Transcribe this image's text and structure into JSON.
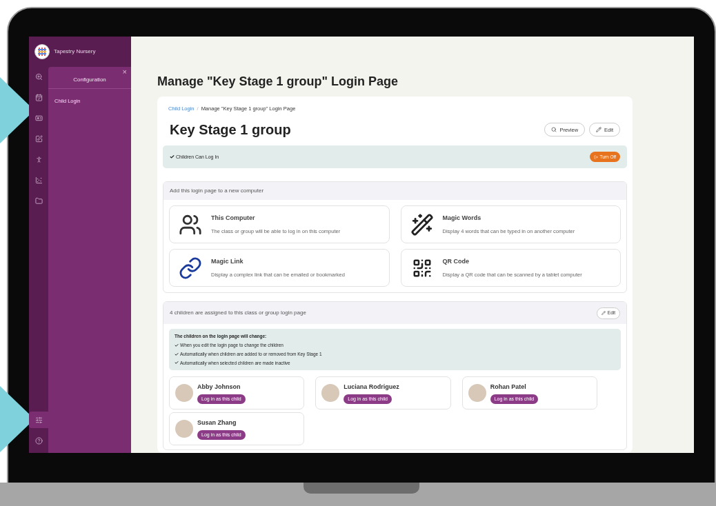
{
  "sidebar": {
    "brand": "Tapestry Nursery",
    "rail": [
      {
        "kind": "zoom",
        "selected": false
      },
      {
        "kind": "calendar",
        "selected": false
      },
      {
        "kind": "card",
        "selected": false
      },
      {
        "kind": "note",
        "selected": false
      },
      {
        "kind": "person",
        "selected": false
      },
      {
        "kind": "chart",
        "selected": false
      },
      {
        "kind": "folder",
        "selected": false
      }
    ],
    "rail_bottom": [
      {
        "kind": "sliders",
        "selected": true
      },
      {
        "kind": "help",
        "selected": false
      }
    ],
    "panel": {
      "title": "Configuration",
      "close": "×",
      "items": [
        {
          "label": "Child Login",
          "selected": false
        }
      ]
    }
  },
  "page": {
    "title": "Manage \"Key Stage 1 group\" Login Page",
    "breadcrumb_separator": "/",
    "breadcrumb": [
      {
        "label": "Child Login",
        "kind": "link"
      },
      {
        "label": "Manage \"Key Stage 1 group\" Login Page",
        "kind": "current"
      }
    ],
    "heading": "Key Stage 1 group",
    "actions": [
      {
        "label": "Preview",
        "kind": "search"
      },
      {
        "label": "Edit",
        "kind": "pencil"
      }
    ],
    "status": {
      "text": "Children Can Log In",
      "on": true,
      "button": "Turn Off"
    },
    "add_section": {
      "title": "Add this login page to a new computer",
      "options": [
        {
          "kind": "computer",
          "title": "This Computer",
          "description": "The class or group will be able to log in on this computer"
        },
        {
          "kind": "wand",
          "title": "Magic Words",
          "description": "Display 4 words that can be typed in on another computer"
        },
        {
          "kind": "link",
          "title": "Magic Link",
          "description": "Display a complex link that can be emailed or bookmarked"
        },
        {
          "kind": "qr",
          "title": "QR Code",
          "description": "Display a QR code that can be scanned by a tablet computer"
        }
      ]
    },
    "children_section": {
      "title": "4 children are assigned to this class or group login page",
      "edit": "Edit",
      "notice_title": "The children on the login page will change:",
      "notice_items": [
        "When you edit the login page to change the children",
        "Automatically when children are added to or removed from Key Stage 1",
        "Automatically when selected children are made inactive"
      ],
      "children": [
        {
          "name": "Abby Johnson",
          "button": "Log in as this child"
        },
        {
          "name": "Luciana Rodriguez",
          "button": "Log in as this child"
        },
        {
          "name": "Rohan Patel",
          "button": "Log in as this child"
        },
        {
          "name": "Susan Zhang",
          "button": "Log in as this child"
        }
      ]
    }
  }
}
